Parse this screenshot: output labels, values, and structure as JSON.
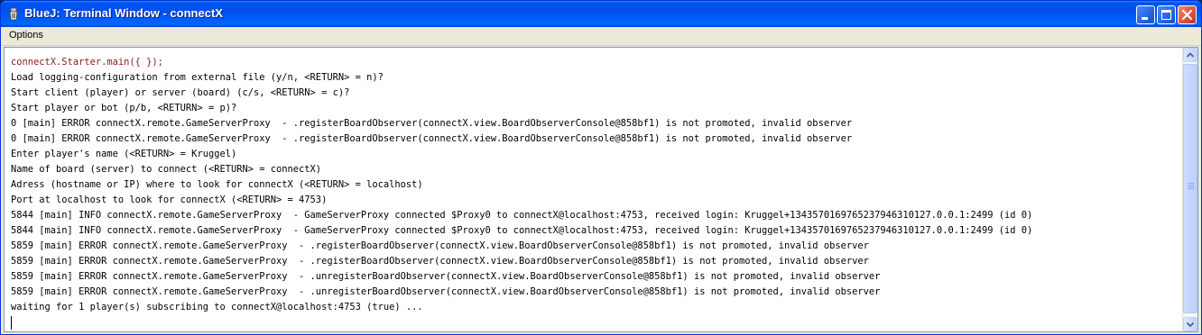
{
  "window": {
    "title": "BlueJ: Terminal Window - connectX",
    "controls": {
      "minimize_icon": "minimize-icon",
      "maximize_icon": "maximize-icon",
      "close_icon": "close-icon"
    }
  },
  "menubar": {
    "items": [
      {
        "label": "Options"
      }
    ]
  },
  "terminal": {
    "invocation_color": "#8b1a1a",
    "lines": [
      "connectX.Starter.main({ });",
      "Load logging-configuration from external file (y/n, <RETURN> = n)?",
      "Start client (player) or server (board) (c/s, <RETURN> = c)?",
      "Start player or bot (p/b, <RETURN> = p)?",
      "0 [main] ERROR connectX.remote.GameServerProxy  - .registerBoardObserver(connectX.view.BoardObserverConsole@858bf1) is not promoted, invalid observer",
      "0 [main] ERROR connectX.remote.GameServerProxy  - .registerBoardObserver(connectX.view.BoardObserverConsole@858bf1) is not promoted, invalid observer",
      "Enter player's name (<RETURN> = Kruggel)",
      "Name of board (server) to connect (<RETURN> = connectX)",
      "Adress (hostname or IP) where to look for connectX (<RETURN> = localhost)",
      "Port at localhost to look for connectX (<RETURN> = 4753)",
      "5844 [main] INFO connectX.remote.GameServerProxy  - GameServerProxy connected $Proxy0 to connectX@localhost:4753, received login: Kruggel+1343570169765237946310127.0.0.1:2499 (id 0)",
      "5844 [main] INFO connectX.remote.GameServerProxy  - GameServerProxy connected $Proxy0 to connectX@localhost:4753, received login: Kruggel+1343570169765237946310127.0.0.1:2499 (id 0)",
      "5859 [main] ERROR connectX.remote.GameServerProxy  - .registerBoardObserver(connectX.view.BoardObserverConsole@858bf1) is not promoted, invalid observer",
      "5859 [main] ERROR connectX.remote.GameServerProxy  - .registerBoardObserver(connectX.view.BoardObserverConsole@858bf1) is not promoted, invalid observer",
      "5859 [main] ERROR connectX.remote.GameServerProxy  - .unregisterBoardObserver(connectX.view.BoardObserverConsole@858bf1) is not promoted, invalid observer",
      "5859 [main] ERROR connectX.remote.GameServerProxy  - .unregisterBoardObserver(connectX.view.BoardObserverConsole@858bf1) is not promoted, invalid observer",
      "waiting for 1 player(s) subscribing to connectX@localhost:4753 (true) ..."
    ]
  },
  "scrollbar": {
    "up_icon": "scroll-up-arrow-icon",
    "down_icon": "scroll-down-arrow-icon"
  }
}
